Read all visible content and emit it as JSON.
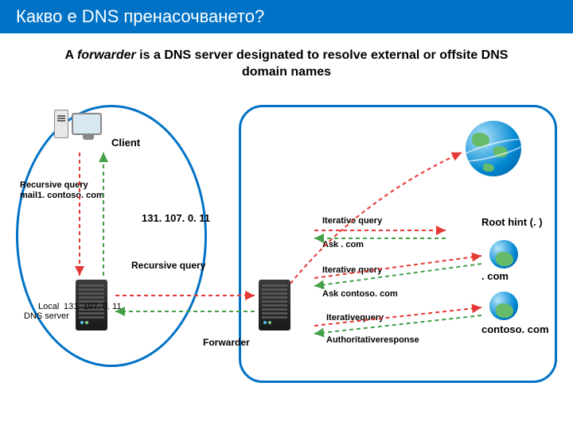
{
  "header": {
    "title": "Какво е DNS пренасочването?"
  },
  "subtitle": {
    "prefix": "A ",
    "em": "forwarder",
    "rest": " is a DNS server designated to resolve external or offsite DNS domain names"
  },
  "labels": {
    "client": "Client",
    "recursive_query": "Recursive query",
    "mail_host": "mail1. contoso. com",
    "ip1": "131. 107. 0. 11",
    "recursive_query2": "Recursive query",
    "local_dns": "Local",
    "local_dns2": "DNS server",
    "ip2": "131. 107. 0. 11",
    "forwarder": "Forwarder",
    "iter1": "Iterative query",
    "ask_com": "Ask . com",
    "iter2": "Iterative query",
    "ask_contoso": "Ask contoso. com",
    "iter3": "Iterativequery",
    "auth_resp": "Authoritativeresponse",
    "root_hint": "Root hint (. )",
    "com": ". com",
    "contoso": "contoso. com"
  },
  "colors": {
    "primary": "#0072c6",
    "red": "#e53935",
    "green": "#43a047"
  }
}
